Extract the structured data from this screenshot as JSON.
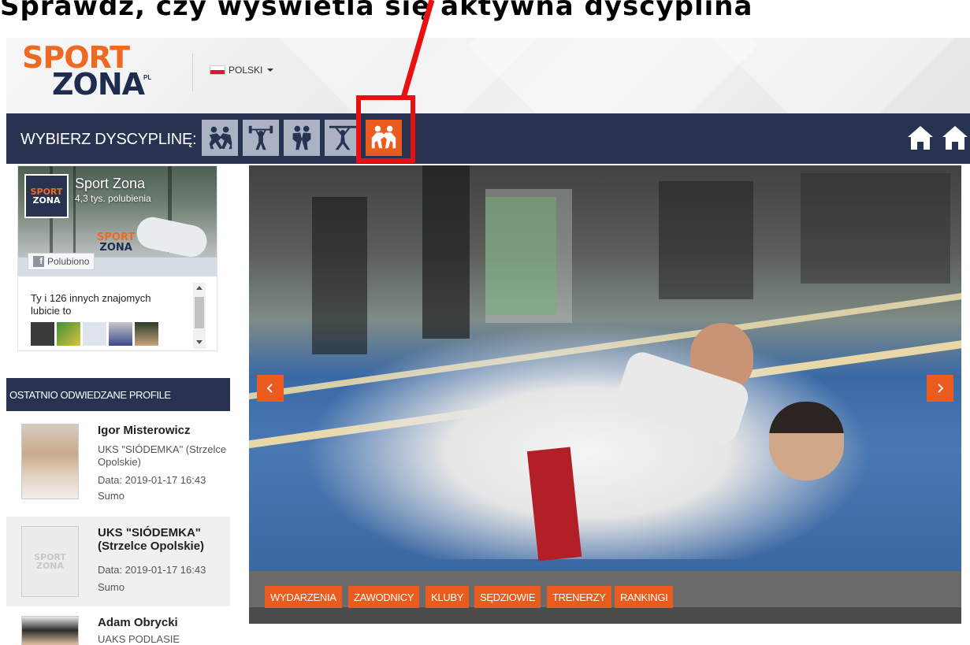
{
  "caption": "Sprawdź, czy wyświetla się aktywna dyscyplina",
  "header": {
    "logo_sport": "SPORT",
    "logo_zona": "ZONA",
    "logo_pl": "PL",
    "language": "POLSKI"
  },
  "nav": {
    "label": "WYBIERZ DYSCYPLINĘ:",
    "disciplines": [
      "wrestling-icon",
      "weightlifting-icon",
      "judo-icon",
      "gymnastics-icon",
      "sumo-icon"
    ],
    "active_index": 4
  },
  "facebook": {
    "page_name": "Sport Zona",
    "likes": "4,3 tys. polubienia",
    "liked_button": "Polubiono",
    "friends_text": "Ty i 126 innych znajomych lubicie to",
    "avatar_sport": "SPORT",
    "avatar_zona": "ZONA",
    "cover_sport": "SPORT",
    "cover_zona": "ZONA"
  },
  "recent": {
    "header": "OSTATNIO ODWIEDZANE PROFILE",
    "profiles": [
      {
        "name": "Igor Misterowicz",
        "club": "UKS \"SIÓDEMKA\" (Strzelce Opolskie)",
        "date": "Data: 2019-01-17 16:43",
        "discipline": "Sumo"
      },
      {
        "name": "UKS \"SIÓDEMKA\" (Strzelce Opolskie)",
        "date": "Data: 2019-01-17 16:43",
        "discipline": "Sumo",
        "logo_sport": "SPORT",
        "logo_zona": "ZONA"
      },
      {
        "name": "Adam Obrycki",
        "club": "UAKS PODLASIE (Białystok)"
      }
    ]
  },
  "slider": {
    "tabs": [
      "WYDARZENIA",
      "ZAWODNICY",
      "KLUBY",
      "SĘDZIOWIE",
      "TRENERZY",
      "RANKINGI"
    ]
  },
  "colors": {
    "accent": "#ec5b1e",
    "navy": "#273350",
    "icon_inactive": "#aab2c3"
  }
}
